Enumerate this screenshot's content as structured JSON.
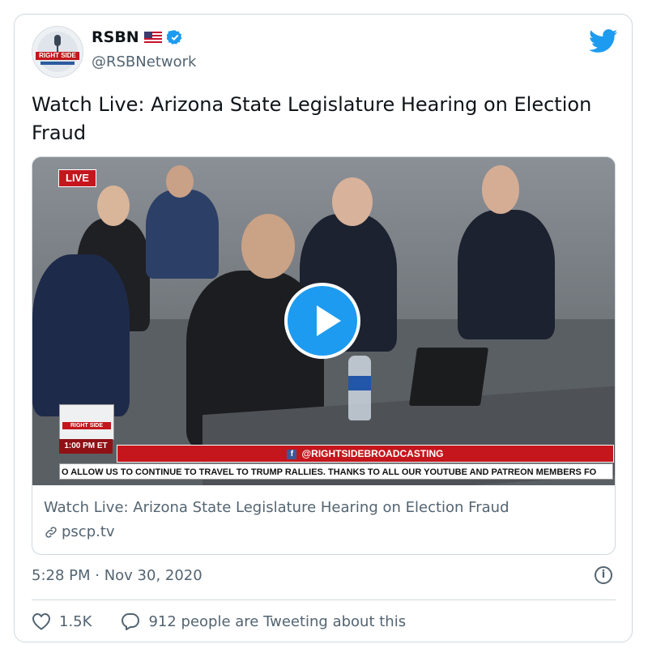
{
  "header": {
    "avatar_text": "RIGHT SIDE",
    "display_name": "RSBN",
    "handle": "@RSBNetwork"
  },
  "tweet": {
    "text": "Watch Live: Arizona State Legislature Hearing on Election Fraud"
  },
  "media": {
    "live_badge": "LIVE",
    "logo_text": "RIGHT SIDE",
    "time_label": "1:00 PM ET",
    "social_handle": "@RIGHTSIDEBROADCASTING",
    "ticker_text": "O ALLOW US TO CONTINUE TO TRAVEL TO TRUMP RALLIES.   THANKS TO ALL OUR YOUTUBE AND PATREON MEMBERS FO"
  },
  "link_card": {
    "title": "Watch Live: Arizona State Legislature Hearing on Election Fraud",
    "domain": "pscp.tv"
  },
  "footer": {
    "timestamp": "5:28 PM · Nov 30, 2020",
    "likes": "1.5K",
    "tweeting": "912 people are Tweeting about this"
  },
  "colors": {
    "twitter_blue": "#1d9bf0",
    "brand_red": "#c4161c",
    "muted_text": "#536471"
  },
  "icons": [
    "twitter-bird-icon",
    "verified-badge-icon",
    "us-flag-icon",
    "play-icon",
    "link-icon",
    "info-icon",
    "heart-icon",
    "reply-bubble-icon",
    "facebook-icon"
  ]
}
